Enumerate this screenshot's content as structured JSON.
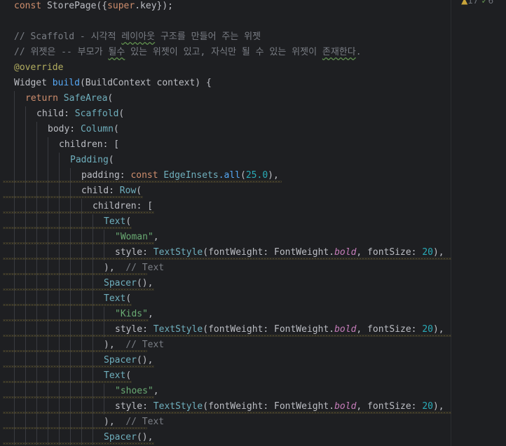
{
  "status": {
    "warnings": "17",
    "typos": "6",
    "chevron": "^"
  },
  "lines": [
    "const StorePage({super.key});",
    "",
    "// Scaffold - 시각적 레이아웃 구조를 만들어 주는 위젯",
    "// 위젯은 -- 부모가 될수 있는 위젯이 있고, 자식만 될 수 있는 위젯이 존재한다.",
    "@override",
    "Widget build(BuildContext context) {",
    "return SafeArea(",
    "child: Scaffold(",
    "body: Column(",
    "children: [",
    "Padding(",
    "padding: const EdgeInsets.all(25.0),",
    "child: Row(",
    "children: [",
    "Text(",
    "\"Woman\",",
    "style: TextStyle(fontWeight: FontWeight.bold, fontSize: 20),",
    "),  // Text",
    "Spacer(),",
    "Text(",
    "\"Kids\",",
    "style: TextStyle(fontWeight: FontWeight.bold, fontSize: 20),",
    "),  // Text",
    "Spacer(),",
    "Text(",
    "\"shoes\",",
    "style: TextStyle(fontWeight: FontWeight.bold, fontSize: 20),",
    "),  // Text",
    "Spacer(),"
  ],
  "tokens": {
    "kw_const": "const",
    "StorePage": "StorePage",
    "super": "super",
    "key": ".key",
    "comment1": "// Scaffold - 시각적 ",
    "comment1_wave": "레이아웃",
    "comment1_rest": " 구조를 만들어 주는 위젯",
    "comment2": "// 위젯은 -- 부모가 ",
    "comment2_w1": "될수",
    "comment2_mid": " 있는 위젯이 있고, 자식만 될 수 있는 위젯이 ",
    "comment2_w2": "존재한다",
    "comment2_end": ".",
    "override": "@override",
    "Widget": "Widget ",
    "build": "build",
    "buildargs": "(BuildContext context) {",
    "return": "return ",
    "SafeArea": "SafeArea",
    "child": "child: ",
    "Scaffold": "Scaffold",
    "body": "body: ",
    "Column": "Column",
    "children": "children: [",
    "Padding": "Padding",
    "padding": "padding: ",
    "EdgeInsets": "EdgeInsets",
    "all": ".all",
    "num25": "25.0",
    "Row": "Row",
    "Text": "Text",
    "Woman": "\"Woman\"",
    "Kids": "\"Kids\"",
    "shoes": "\"shoes\"",
    "style": "style: ",
    "TextStyle": "TextStyle",
    "fontWeight": "(fontWeight: FontWeight.",
    "bold": "bold",
    "fontSize": ", fontSize: ",
    "num20": "20",
    "closeText": "),  ",
    "hintText": "// Text",
    "Spacer": "Spacer"
  }
}
